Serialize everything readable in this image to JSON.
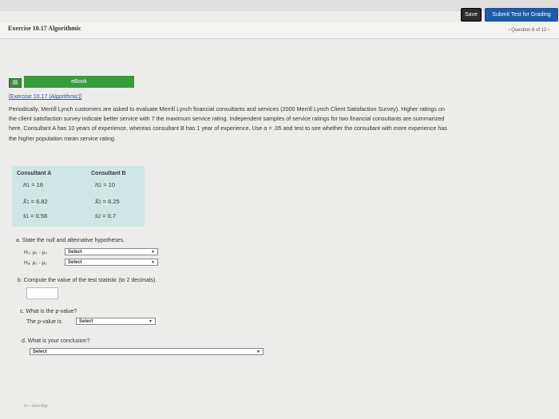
{
  "header": {
    "save_label": "Save",
    "submit_label": "Submit Test for Grading",
    "title": "Exercise 10.17 Algorithmic",
    "question_nav": "‹ Question 8 of 12 ›"
  },
  "ebook": {
    "label": "eBook",
    "icon": "book-icon",
    "exercise_link": "[Exercise 10.17 (Algorithmic)]"
  },
  "problem": {
    "lines": [
      "Periodically, Merrill Lynch customers are asked to evaluate Merrill Lynch financial consultants and services (2000 Merrill Lynch Client Satisfaction Survey). Higher ratings on",
      "the client satisfaction survey indicate better service with 7 the maximum service rating. Independent samples of service ratings for two financial consultants are summarized",
      "here. Consultant A has 10 years of experience, whereas consultant B has 1 year of experience. Use α = .05 and test to see whether the consultant with more experience has",
      "the higher population mean service rating."
    ]
  },
  "table": {
    "col_a": "Consultant A",
    "col_b": "Consultant B",
    "a": {
      "n_sym": "n",
      "n_sub": "1",
      "n_val": "= 16",
      "x_sym": "x̄",
      "x_sub": "1",
      "x_val": "= 6.82",
      "s_sym": "s",
      "s_sub": "1",
      "s_val": "= 0.58"
    },
    "b": {
      "n_sym": "n",
      "n_sub": "2",
      "n_val": "= 10",
      "x_sym": "x̄",
      "x_sub": "2",
      "x_val": "= 6.25",
      "s_sym": "s",
      "s_sub": "2",
      "s_val": "= 0.7"
    }
  },
  "questions": {
    "a_label": "a. State the null and alternative hypotheses.",
    "h0_label": "H₀: μ₁ - μ₂",
    "ha_label": "Hₐ: μ₁ - μ₂",
    "b_label": "b. Compute the value of the test statistic (to 2 decimals).",
    "c_label": "c. What is the p-value?",
    "c_sub_label": "The p-value is",
    "d_label": "d. What is your conclusion?",
    "select_placeholder": "Select",
    "arrow": "▼"
  },
  "footer": {
    "icon_key": "O— Icon Key"
  }
}
